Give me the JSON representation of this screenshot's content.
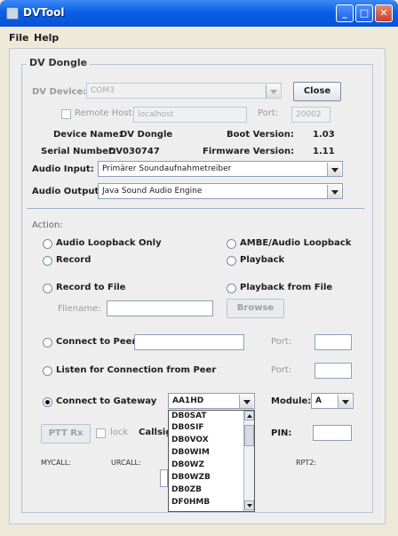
{
  "window": {
    "title": "DVTool"
  },
  "menu": [
    "File",
    "Help"
  ],
  "group": {
    "title": "DV Dongle",
    "dv_device_label": "DV Device:",
    "dv_device_value": "COM3",
    "close_label": "Close",
    "remote_host_label": "Remote Host:",
    "remote_host_value": "localhost",
    "port_label": "Port:",
    "port_value": "20002",
    "device_name_label": "Device Name:",
    "device_name_value": "DV Dongle",
    "boot_version_label": "Boot Version:",
    "boot_version_value": "1.03",
    "serial_number_label": "Serial Number:",
    "serial_number_value": "DV030747",
    "firmware_version_label": "Firmware Version:",
    "firmware_version_value": "1.11",
    "audio_input_label": "Audio Input:",
    "audio_input_value": "Primärer Soundaufnahmetreiber",
    "audio_output_label": "Audio Output:",
    "audio_output_value": "Java Sound Audio Engine"
  },
  "action": {
    "label": "Action:",
    "audio_loopback": "Audio Loopback Only",
    "ambe_loopback": "AMBE/Audio Loopback",
    "record": "Record",
    "playback": "Playback",
    "record_to_file": "Record to File",
    "playback_from_file": "Playback from File",
    "filename_label": "Filename:",
    "filename_value": "",
    "browse_label": "Browse",
    "connect_to_peer": "Connect to Peer",
    "peer_value": "",
    "peer_port_label": "Port:",
    "peer_port_value": "",
    "listen_peer": "Listen for Connection from Peer",
    "listen_port_label": "Port:",
    "listen_port_value": "",
    "connect_gateway": "Connect to Gateway",
    "gateway_value": "AA1HD",
    "module_label": "Module:",
    "module_value": "A",
    "ptt_label": "PTT Rx",
    "lock_label": "lock",
    "callsign_label": "Callsig",
    "pin_label": "PIN:",
    "pin_value": "",
    "mycall_label": "MYCALL:",
    "urcall_label": "URCALL:",
    "rpt2_label": "RPT2:"
  },
  "gateway_list": [
    "DB0SAT",
    "DB0SIF",
    "DB0VOX",
    "DB0WIM",
    "DB0WZ",
    "DB0WZB",
    "DB0ZB",
    "DF0HMB"
  ]
}
